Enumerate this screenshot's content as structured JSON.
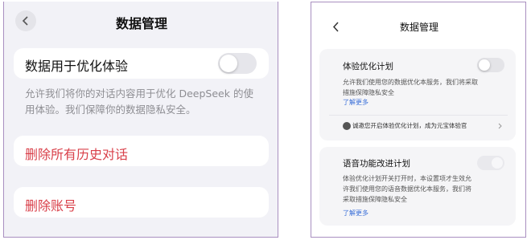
{
  "left": {
    "title": "数据管理",
    "toggle_label": "数据用于优化体验",
    "description": "允许我们将你的对话内容用于优化 DeepSeek 的使用体验。我们保障你的数据隐私安全。",
    "delete_history": "删除所有历史对话",
    "delete_account": "删除账号"
  },
  "right": {
    "title": "数据管理",
    "plan_title": "体验优化计划",
    "plan_desc": "允许我们使用您的数据优化本服务，我们将采取措施保障隐私安全",
    "plan_link": "了解更多",
    "invite": "诚邀您开启体验优化计划，成为元宝体验官",
    "voice_title": "语音功能改进计划",
    "voice_desc": "体验优化计划开关打开时，本设置项才生效允许我们使用您的语音数据优化本服务，我们将采取措施保障隐私安全",
    "voice_link": "了解更多"
  }
}
